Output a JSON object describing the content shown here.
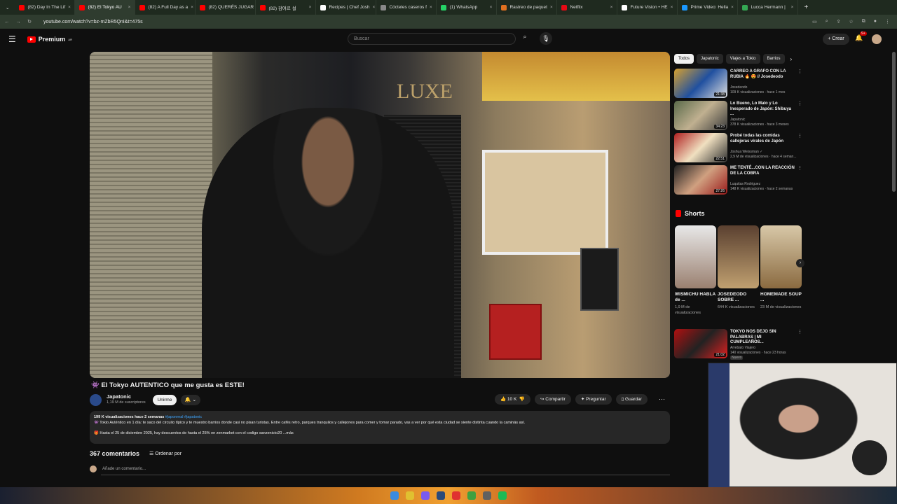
{
  "browser": {
    "tabs": [
      {
        "label": "(82) Day In The Lif",
        "color": "#ff0000"
      },
      {
        "label": "(82) El Tokyo AU",
        "color": "#ff0000",
        "active": true
      },
      {
        "label": "(82) A Full Day as a",
        "color": "#ff0000"
      },
      {
        "label": "(82) QUERÉS JUGAR",
        "color": "#ff0000"
      },
      {
        "label": "(82) 감여르 설",
        "color": "#ff0000"
      },
      {
        "label": "Recipes | Chef Josh",
        "color": "#ffffff"
      },
      {
        "label": "Cócteles caseros f",
        "color": "#888888"
      },
      {
        "label": "(1) WhatsApp",
        "color": "#25d366"
      },
      {
        "label": "Rastreo de paquet",
        "color": "#e07020"
      },
      {
        "label": "Netflix",
        "color": "#e50914"
      },
      {
        "label": "Future Vision • HE",
        "color": "#ffffff"
      },
      {
        "label": "Prime Video: Hella",
        "color": "#1a98ff"
      },
      {
        "label": "Lucca Hermann |",
        "color": "#34a853"
      }
    ],
    "url": "youtube.com/watch?v=bz-mZbR5QnI&t=475s"
  },
  "header": {
    "logo_text": "Premium",
    "logo_sup": "AR",
    "search_placeholder": "Buscar",
    "create_label": "+ Crear",
    "notif_count": "9+"
  },
  "video": {
    "title": "👾 El Tokyo AUTENTICO que me gusta es ESTE!",
    "channel": "Japatonic",
    "subscribers": "1,19 M de suscriptores",
    "join_label": "Unirme",
    "likes": "10 K",
    "share_label": "Compartir",
    "ask_label": "Preguntar",
    "save_label": "Guardar",
    "sign_text": "LUXE"
  },
  "description": {
    "meta": "199 K visualizaciones  hace 2 semanas",
    "tags": " #japonreal #japatonic",
    "line1": "👾 Tokio Auténtico en 1 día: te saco del circuito típico y te muestro barrios donde casi no pisan turistas. Entre cafés retro, parques tranquilos y callejones para comer y tomar parado, vas a ver por qué esta ciudad se siente distinta cuando la caminás así.",
    "line2": "🎁 Hasta el 25 de diciembre 2025, hay descuentos de hasta el 25% en zenmarket con el codigo sanzenicto20 ...más"
  },
  "comments": {
    "count": "367 comentarios",
    "sort_label": "Ordenar por",
    "add_placeholder": "Añade un comentario..."
  },
  "sidebar": {
    "chips": [
      "Todos",
      "Japatonic",
      "Viajes a Tokio",
      "Barrios"
    ],
    "recs": [
      {
        "title": "CARREO A GRAFO CON LA RUBIA 🔥 😍 // Josedeodo",
        "channel": "Josedeodo",
        "views": "109 K visualizaciones · hace 1 mes",
        "duration": "21:38"
      },
      {
        "title": "Lo Bueno, Lo Malo y Lo Inesperado de Japón: Shibuya ...",
        "channel": "Japatonic",
        "views": "378 K visualizaciones · hace 3 meses",
        "duration": "34:23"
      },
      {
        "title": "Probé todas las comidas callejeras virales de Japón",
        "channel": "Joshua Weissman ✓",
        "views": "2,9 M de visualizaciones · hace 4 seman...",
        "duration": "22:51"
      },
      {
        "title": "ME TENTÉ...CON LA REACCIÓN DE LA COBRA",
        "channel": "Luquitas Rodriguez",
        "views": "148 K visualizaciones · hace 2 semanas",
        "duration": "27:26"
      }
    ],
    "shorts_label": "Shorts",
    "shorts": [
      {
        "title": "WISMICHU HABLA de ...",
        "views": "1,9 M de visualizaciones"
      },
      {
        "title": "JOSEDEODO SOBRE ...",
        "views": "644 K visualizaciones"
      },
      {
        "title": "HOMEMADE SOUP ...",
        "views": "23 M de visualizaciones"
      }
    ],
    "rec5": {
      "title": "TOKYO NOS DEJO SIN PALABRAS | MI CUMPLEAÑOS...",
      "channel": "Arrebato Viajero",
      "views": "140 visualizaciones · hace 23 horas",
      "badge": "Nuevo",
      "duration": "21:02"
    }
  },
  "colors": {
    "accent": "#ff0000",
    "link": "#3ea6ff",
    "bg": "#0f0f0f",
    "chip_bg": "#272727"
  },
  "taskbar_icons": [
    "windows-icon",
    "chrome-icon",
    "discord-icon",
    "steam-icon",
    "redis-icon",
    "leaf-icon",
    "obs-icon",
    "spotify-icon"
  ]
}
